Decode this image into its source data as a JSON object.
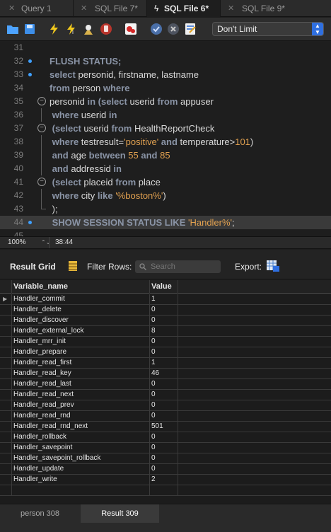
{
  "tabs": [
    {
      "label": "Query 1",
      "active": false
    },
    {
      "label": "SQL File 7*",
      "active": false
    },
    {
      "label": "SQL File 6*",
      "active": true
    },
    {
      "label": "SQL File 9*",
      "active": false
    }
  ],
  "toolbar": {
    "limit_label": "Don't Limit",
    "icons": [
      "open-folder-icon",
      "save-icon",
      "execute-icon",
      "execute-current-icon",
      "explain-icon",
      "stop-icon",
      "toggle-error-icon",
      "commit-icon",
      "rollback-icon",
      "auto-commit-icon"
    ]
  },
  "editor": {
    "lines": [
      {
        "n": "31",
        "segs": []
      },
      {
        "n": "32",
        "segs": [
          {
            "t": "FLUSH STATUS;",
            "c": "kw"
          }
        ]
      },
      {
        "n": "33",
        "segs": [
          {
            "t": "select ",
            "c": "kw"
          },
          {
            "t": "personid, firstname, lastname",
            "c": ""
          }
        ]
      },
      {
        "n": "34",
        "segs": [
          {
            "t": "from ",
            "c": "kw"
          },
          {
            "t": "person ",
            "c": ""
          },
          {
            "t": "where",
            "c": "kw"
          }
        ]
      },
      {
        "n": "35",
        "segs": [
          {
            "t": "personid ",
            "c": ""
          },
          {
            "t": "in (select ",
            "c": "kw"
          },
          {
            "t": "userid ",
            "c": ""
          },
          {
            "t": "from ",
            "c": "kw"
          },
          {
            "t": "appuser",
            "c": ""
          }
        ]
      },
      {
        "n": "36",
        "segs": [
          {
            "t": " where ",
            "c": "kw"
          },
          {
            "t": "userid ",
            "c": ""
          },
          {
            "t": "in",
            "c": "kw"
          }
        ]
      },
      {
        "n": "37",
        "segs": [
          {
            "t": " (select ",
            "c": "kw"
          },
          {
            "t": "userid ",
            "c": ""
          },
          {
            "t": "from ",
            "c": "kw"
          },
          {
            "t": "HealthReportCheck",
            "c": ""
          }
        ]
      },
      {
        "n": "38",
        "segs": [
          {
            "t": " where ",
            "c": "kw"
          },
          {
            "t": "testresult=",
            "c": ""
          },
          {
            "t": "'positive'",
            "c": "str"
          },
          {
            "t": " and ",
            "c": "kw"
          },
          {
            "t": "temperature>",
            "c": ""
          },
          {
            "t": "101",
            "c": "num"
          },
          {
            "t": ")",
            "c": ""
          }
        ]
      },
      {
        "n": "39",
        "segs": [
          {
            "t": " and ",
            "c": "kw"
          },
          {
            "t": "age ",
            "c": ""
          },
          {
            "t": "between ",
            "c": "kw"
          },
          {
            "t": "55",
            "c": "num"
          },
          {
            "t": " and ",
            "c": "kw"
          },
          {
            "t": "85",
            "c": "num"
          }
        ]
      },
      {
        "n": "40",
        "segs": [
          {
            "t": " and ",
            "c": "kw"
          },
          {
            "t": "addressid ",
            "c": ""
          },
          {
            "t": "in",
            "c": "kw"
          }
        ]
      },
      {
        "n": "41",
        "segs": [
          {
            "t": " (select ",
            "c": "kw"
          },
          {
            "t": "placeid ",
            "c": ""
          },
          {
            "t": "from ",
            "c": "kw"
          },
          {
            "t": "place",
            "c": ""
          }
        ]
      },
      {
        "n": "42",
        "segs": [
          {
            "t": " where ",
            "c": "kw"
          },
          {
            "t": "city ",
            "c": ""
          },
          {
            "t": "like ",
            "c": "kw"
          },
          {
            "t": "'%boston%'",
            "c": "str"
          },
          {
            "t": ")",
            "c": ""
          }
        ]
      },
      {
        "n": "43",
        "segs": [
          {
            "t": " );",
            "c": ""
          }
        ]
      },
      {
        "n": "44",
        "segs": [
          {
            "t": " SHOW SESSION STATUS LIKE ",
            "c": "kw"
          },
          {
            "t": "'Handler%'",
            "c": "str"
          },
          {
            "t": ";",
            "c": ""
          }
        ]
      },
      {
        "n": "45",
        "segs": []
      }
    ]
  },
  "status": {
    "zoom": "100%",
    "cursor": "38:44"
  },
  "results": {
    "grid_label": "Result Grid",
    "filter_label": "Filter Rows:",
    "search_placeholder": "Search",
    "export_label": "Export:",
    "columns": [
      "Variable_name",
      "Value"
    ],
    "rows": [
      [
        "Handler_commit",
        "1"
      ],
      [
        "Handler_delete",
        "0"
      ],
      [
        "Handler_discover",
        "0"
      ],
      [
        "Handler_external_lock",
        "8"
      ],
      [
        "Handler_mrr_init",
        "0"
      ],
      [
        "Handler_prepare",
        "0"
      ],
      [
        "Handler_read_first",
        "1"
      ],
      [
        "Handler_read_key",
        "46"
      ],
      [
        "Handler_read_last",
        "0"
      ],
      [
        "Handler_read_next",
        "0"
      ],
      [
        "Handler_read_prev",
        "0"
      ],
      [
        "Handler_read_rnd",
        "0"
      ],
      [
        "Handler_read_rnd_next",
        "501"
      ],
      [
        "Handler_rollback",
        "0"
      ],
      [
        "Handler_savepoint",
        "0"
      ],
      [
        "Handler_savepoint_rollback",
        "0"
      ],
      [
        "Handler_update",
        "0"
      ],
      [
        "Handler_write",
        "2"
      ]
    ]
  },
  "bottom_tabs": [
    {
      "label": "person 308",
      "active": false
    },
    {
      "label": "Result 309",
      "active": true
    }
  ]
}
